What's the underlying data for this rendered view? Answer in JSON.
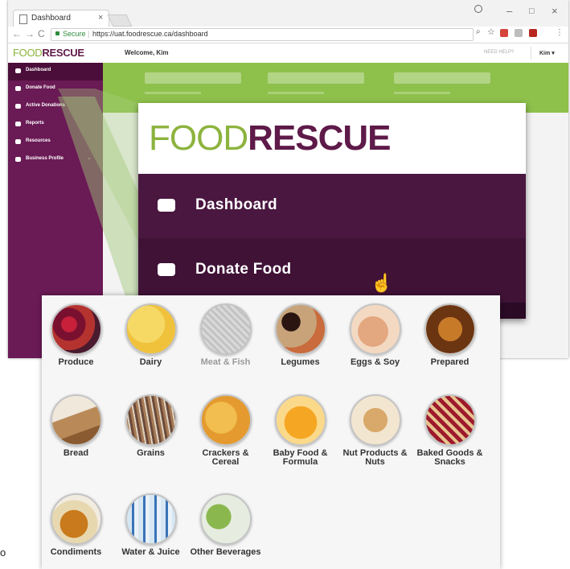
{
  "browser": {
    "tab_title": "Dashboard",
    "tab_close": "×",
    "minimize": "–",
    "maximize": "□",
    "close": "×",
    "back": "←",
    "forward": "→",
    "reload": "C",
    "secure_label": "Secure",
    "url": "https://uat.foodrescue.ca/dashboard"
  },
  "app_header": {
    "logo_food": "FOOD",
    "logo_rescue": "RESCUE",
    "welcome": "Welcome, Kim",
    "need_help": "NEED HELP?",
    "user_name": "Kim",
    "user_caret": "▾"
  },
  "sidebar": {
    "items": [
      {
        "label": "Dashboard",
        "icon": "dashboard-icon"
      },
      {
        "label": "Donate Food",
        "icon": "donate-food-icon"
      },
      {
        "label": "Active Donations",
        "icon": "active-donations-icon"
      },
      {
        "label": "Reports",
        "icon": "reports-icon"
      },
      {
        "label": "Resources",
        "icon": "resources-icon"
      },
      {
        "label": "Business Profile",
        "icon": "business-profile-icon",
        "chevron": "⌄"
      }
    ]
  },
  "zoom_panel": {
    "logo_food": "FOOD",
    "logo_rescue": "RESCUE",
    "dashboard_label": "Dashboard",
    "donate_label": "Donate Food"
  },
  "categories": [
    {
      "label": "Produce",
      "muted": false
    },
    {
      "label": "Dairy",
      "muted": false
    },
    {
      "label": "Meat & Fish",
      "muted": true
    },
    {
      "label": "Legumes",
      "muted": false
    },
    {
      "label": "Eggs & Soy",
      "muted": false
    },
    {
      "label": "Prepared",
      "muted": false
    },
    {
      "label": "Bread",
      "muted": false
    },
    {
      "label": "Grains",
      "muted": false
    },
    {
      "label": "Crackers & Cereal",
      "muted": false
    },
    {
      "label": "Baby Food & Formula",
      "muted": false
    },
    {
      "label": "Nut Products & Nuts",
      "muted": false
    },
    {
      "label": "Baked Goods & Snacks",
      "muted": false
    },
    {
      "label": "Condiments",
      "muted": false
    },
    {
      "label": "Water & Juice",
      "muted": false
    },
    {
      "label": "Other Beverages",
      "muted": false
    }
  ],
  "stray_text": "o",
  "colors": {
    "brand_purple": "#6a1a55",
    "brand_dark_purple": "#4a1740",
    "brand_green": "#8cb33d",
    "banner_green": "#8ec04c"
  }
}
